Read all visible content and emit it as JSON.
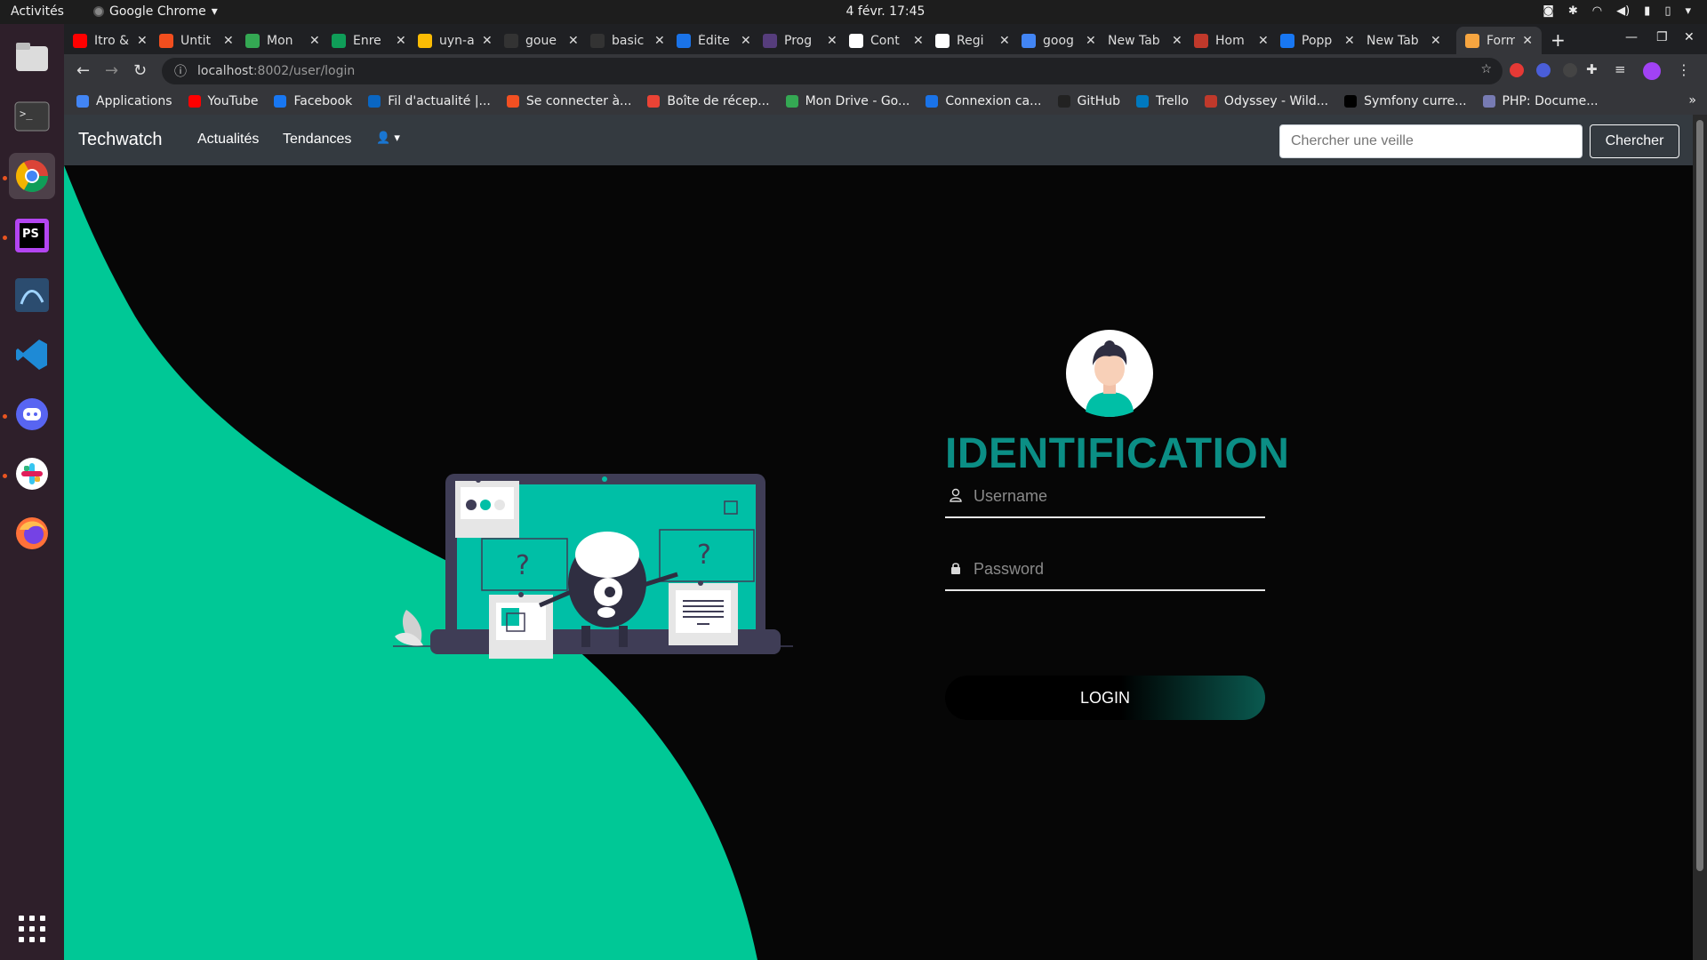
{
  "system": {
    "activities": "Activités",
    "app_name": "Google Chrome",
    "clock": "4 févr.  17:45"
  },
  "browser": {
    "tabs": [
      {
        "title": "Itro &",
        "color": "#ff0000",
        "active": false
      },
      {
        "title": "Untit",
        "color": "#f24e1e",
        "active": false
      },
      {
        "title": "Mon",
        "color": "#34a853",
        "active": false
      },
      {
        "title": "Enre",
        "color": "#0f9d58",
        "active": false
      },
      {
        "title": "uyn-a",
        "color": "#fbbc04",
        "active": false
      },
      {
        "title": "goue",
        "color": "#333333",
        "active": false
      },
      {
        "title": "basic",
        "color": "#333333",
        "active": false
      },
      {
        "title": "Édite",
        "color": "#1a73e8",
        "active": false
      },
      {
        "title": "Prog",
        "color": "#563d7c",
        "active": false
      },
      {
        "title": "Cont",
        "color": "#ffffff",
        "active": false
      },
      {
        "title": "Regi",
        "color": "#ffffff",
        "active": false
      },
      {
        "title": "goog",
        "color": "#4285f4",
        "active": false
      },
      {
        "title": "New Tab",
        "color": "",
        "active": false
      },
      {
        "title": "Hom",
        "color": "#c0392b",
        "active": false
      },
      {
        "title": "Popp",
        "color": "#1877f2",
        "active": false
      },
      {
        "title": "New Tab",
        "color": "",
        "active": false
      },
      {
        "title": "Form",
        "color": "#f6a540",
        "active": true
      }
    ],
    "url_host": "localhost",
    "url_path": ":8002/user/login",
    "bookmarks": [
      {
        "label": "Applications",
        "color": "#4285f4"
      },
      {
        "label": "YouTube",
        "color": "#ff0000"
      },
      {
        "label": "Facebook",
        "color": "#1877f2"
      },
      {
        "label": "Fil d'actualité |...",
        "color": "#0a66c2"
      },
      {
        "label": "Se connecter à...",
        "color": "#f25022"
      },
      {
        "label": "Boîte de récep...",
        "color": "#ea4335"
      },
      {
        "label": "Mon Drive - Go...",
        "color": "#34a853"
      },
      {
        "label": "Connexion ca...",
        "color": "#1a73e8"
      },
      {
        "label": "GitHub",
        "color": "#222222"
      },
      {
        "label": "Trello",
        "color": "#0079bf"
      },
      {
        "label": "Odyssey - Wild...",
        "color": "#c0392b"
      },
      {
        "label": "Symfony curre...",
        "color": "#000000"
      },
      {
        "label": "PHP: Docume...",
        "color": "#777bb3"
      }
    ]
  },
  "site": {
    "brand": "Techwatch",
    "nav": {
      "news": "Actualités",
      "trends": "Tendances"
    },
    "search": {
      "placeholder": "Chercher une veille",
      "button": "Chercher"
    },
    "login": {
      "title": "IDENTIFICATION",
      "username_placeholder": "Username",
      "password_placeholder": "Password",
      "button": "LOGIN"
    },
    "colors": {
      "accent": "#00c896",
      "title": "#0b8e85",
      "navbar": "#343a40"
    }
  }
}
